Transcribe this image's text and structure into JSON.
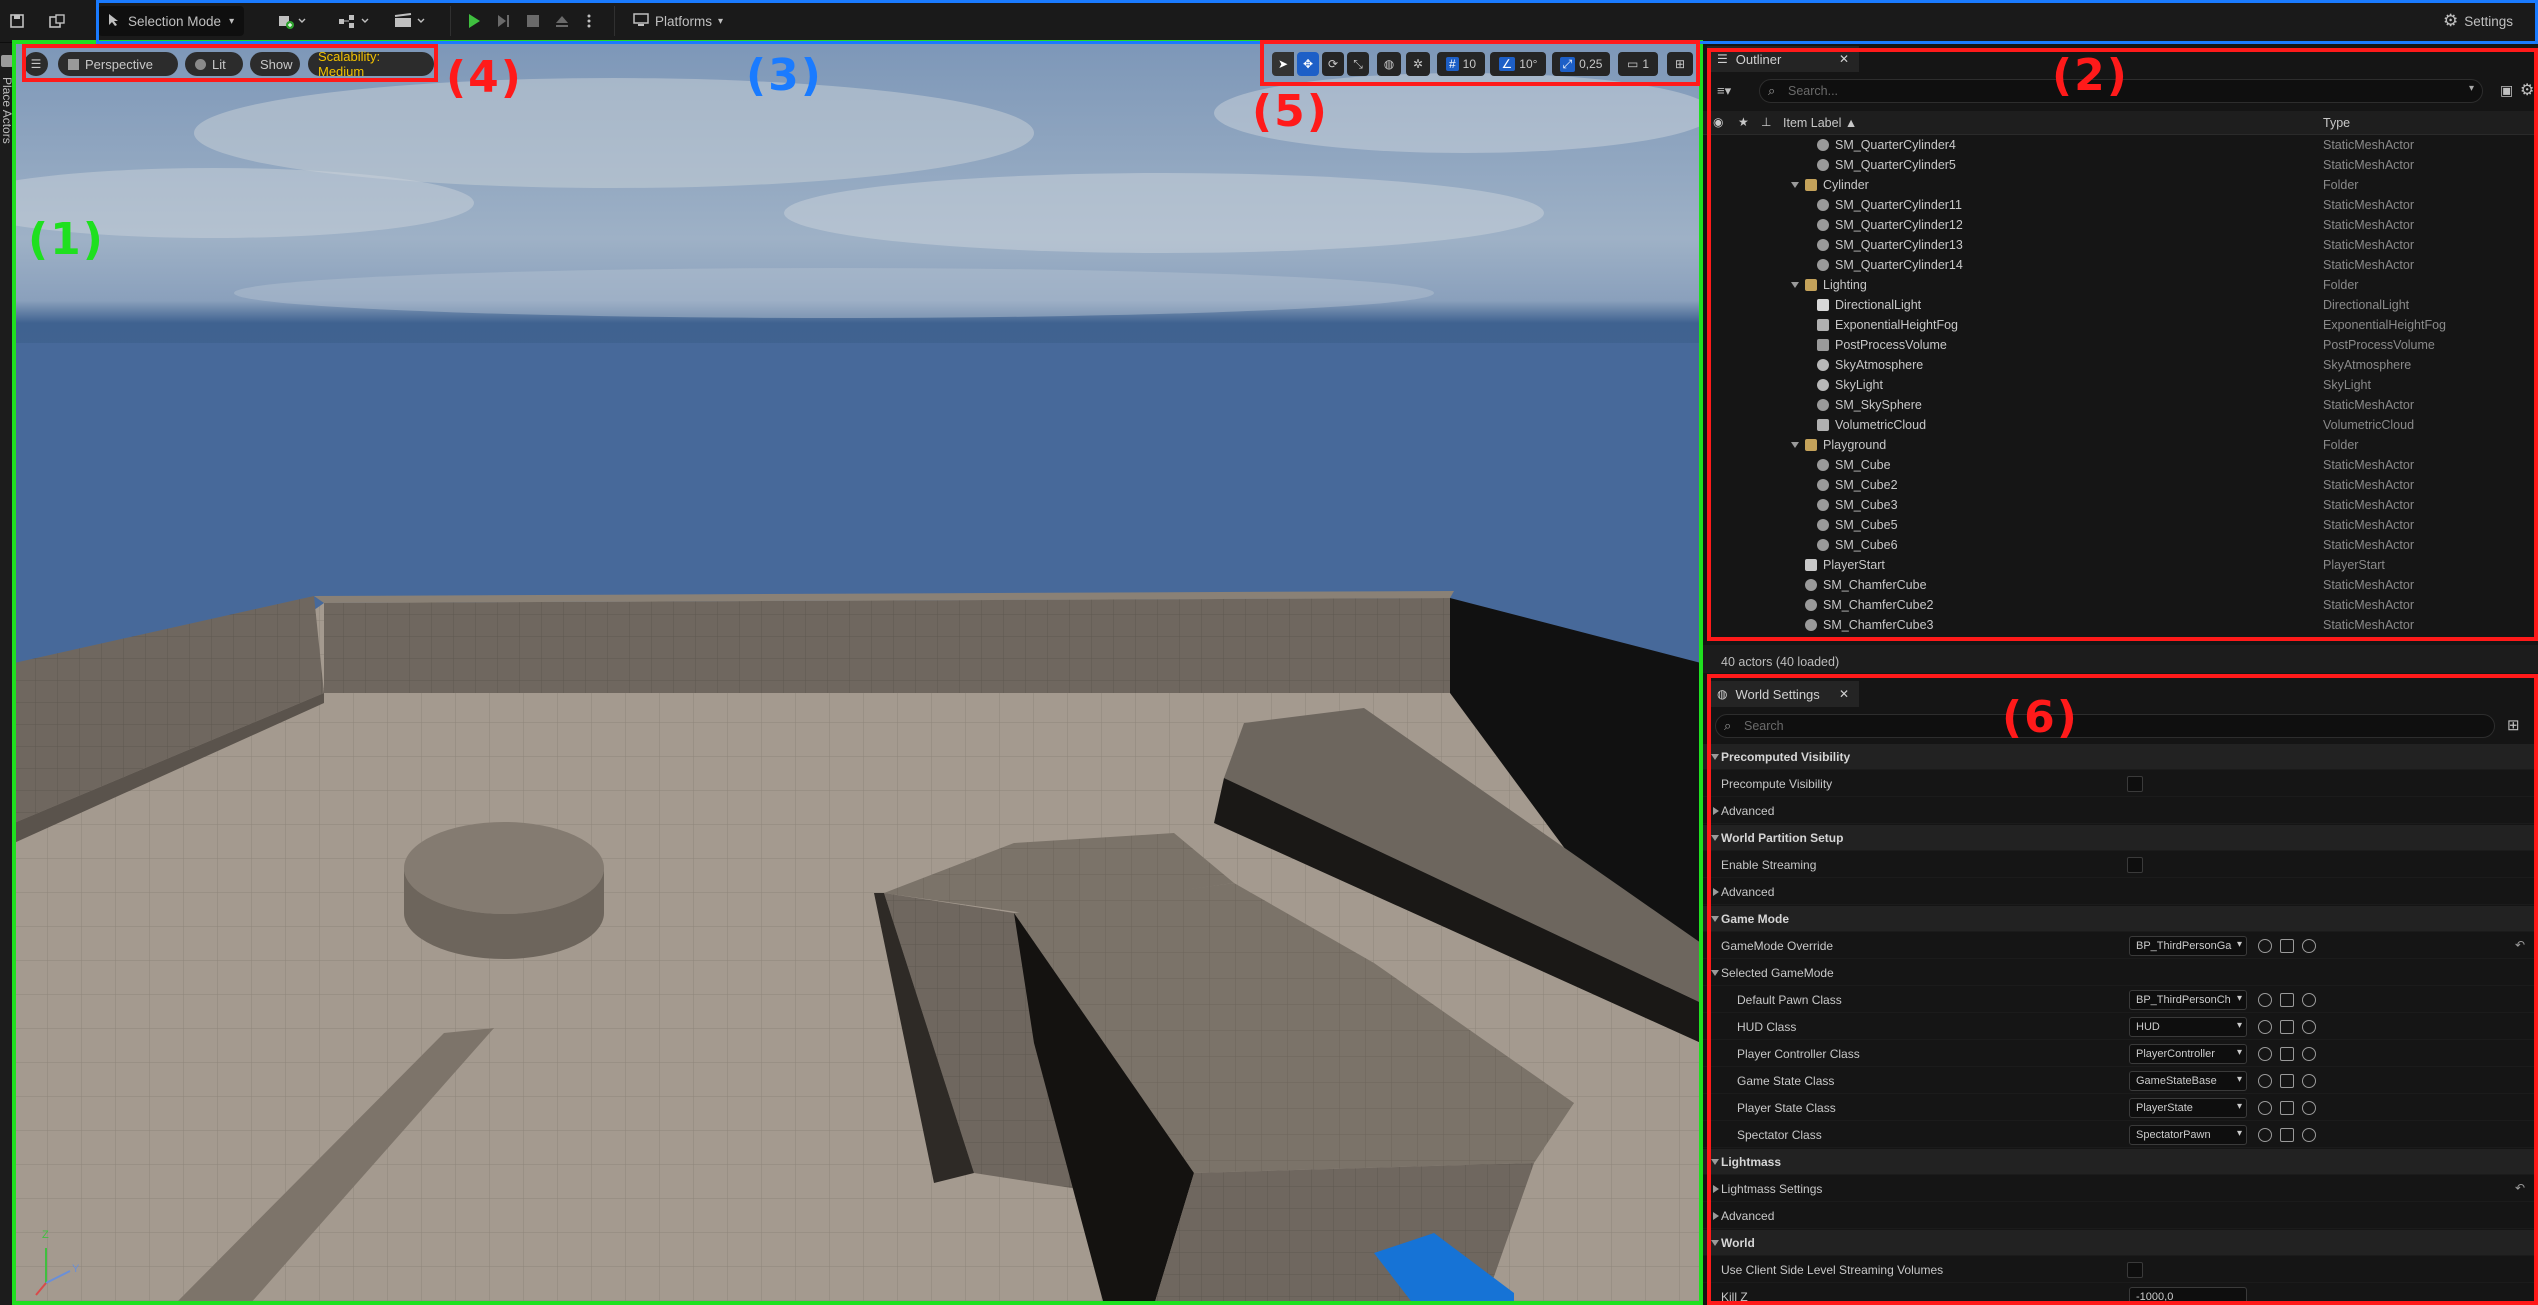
{
  "toolbar": {
    "mode_label": "Selection Mode",
    "platforms_label": "Platforms",
    "settings_label": "Settings"
  },
  "side_strip": {
    "label": "Place Actors"
  },
  "viewport": {
    "perspective_label": "Perspective",
    "lit_label": "Lit",
    "show_label": "Show",
    "scalability_label": "Scalability: Medium",
    "grid_snap_value": "10",
    "rotation_snap_value": "10°",
    "scale_snap_value": "0,25",
    "camera_speed_value": "1",
    "axis_labels": {
      "z": "Z",
      "y": "Y"
    }
  },
  "outliner": {
    "tab_label": "Outliner",
    "search_placeholder": "Search...",
    "col_label": "Item Label ▲",
    "col_type": "Type",
    "rows": [
      {
        "label": "SM_QuarterCylinder4",
        "type": "StaticMeshActor",
        "indent": 2,
        "kind": "mesh"
      },
      {
        "label": "SM_QuarterCylinder5",
        "type": "StaticMeshActor",
        "indent": 2,
        "kind": "mesh"
      },
      {
        "label": "Cylinder",
        "type": "Folder",
        "indent": 1,
        "kind": "folder"
      },
      {
        "label": "SM_QuarterCylinder11",
        "type": "StaticMeshActor",
        "indent": 2,
        "kind": "mesh"
      },
      {
        "label": "SM_QuarterCylinder12",
        "type": "StaticMeshActor",
        "indent": 2,
        "kind": "mesh"
      },
      {
        "label": "SM_QuarterCylinder13",
        "type": "StaticMeshActor",
        "indent": 2,
        "kind": "mesh"
      },
      {
        "label": "SM_QuarterCylinder14",
        "type": "StaticMeshActor",
        "indent": 2,
        "kind": "mesh"
      },
      {
        "label": "Lighting",
        "type": "Folder",
        "indent": 1,
        "kind": "folder"
      },
      {
        "label": "DirectionalLight",
        "type": "DirectionalLight",
        "indent": 2,
        "kind": "light"
      },
      {
        "label": "ExponentialHeightFog",
        "type": "ExponentialHeightFog",
        "indent": 2,
        "kind": "fog"
      },
      {
        "label": "PostProcessVolume",
        "type": "PostProcessVolume",
        "indent": 2,
        "kind": "volume"
      },
      {
        "label": "SkyAtmosphere",
        "type": "SkyAtmosphere",
        "indent": 2,
        "kind": "sky"
      },
      {
        "label": "SkyLight",
        "type": "SkyLight",
        "indent": 2,
        "kind": "sky"
      },
      {
        "label": "SM_SkySphere",
        "type": "StaticMeshActor",
        "indent": 2,
        "kind": "mesh"
      },
      {
        "label": "VolumetricCloud",
        "type": "VolumetricCloud",
        "indent": 2,
        "kind": "cloud"
      },
      {
        "label": "Playground",
        "type": "Folder",
        "indent": 1,
        "kind": "folder"
      },
      {
        "label": "SM_Cube",
        "type": "StaticMeshActor",
        "indent": 2,
        "kind": "mesh"
      },
      {
        "label": "SM_Cube2",
        "type": "StaticMeshActor",
        "indent": 2,
        "kind": "mesh"
      },
      {
        "label": "SM_Cube3",
        "type": "StaticMeshActor",
        "indent": 2,
        "kind": "mesh"
      },
      {
        "label": "SM_Cube5",
        "type": "StaticMeshActor",
        "indent": 2,
        "kind": "mesh"
      },
      {
        "label": "SM_Cube6",
        "type": "StaticMeshActor",
        "indent": 2,
        "kind": "mesh"
      },
      {
        "label": "PlayerStart",
        "type": "PlayerStart",
        "indent": 1,
        "kind": "player"
      },
      {
        "label": "SM_ChamferCube",
        "type": "StaticMeshActor",
        "indent": 1,
        "kind": "mesh"
      },
      {
        "label": "SM_ChamferCube2",
        "type": "StaticMeshActor",
        "indent": 1,
        "kind": "mesh"
      },
      {
        "label": "SM_ChamferCube3",
        "type": "StaticMeshActor",
        "indent": 1,
        "kind": "mesh"
      }
    ],
    "status": "40 actors (40 loaded)"
  },
  "world_settings": {
    "tab_label": "World Settings",
    "search_placeholder": "Search",
    "rows": [
      {
        "kind": "section",
        "label": "Precomputed Visibility"
      },
      {
        "kind": "check",
        "label": "Precompute Visibility",
        "indent": 1
      },
      {
        "kind": "collapsed",
        "label": "Advanced"
      },
      {
        "kind": "section",
        "label": "World Partition Setup"
      },
      {
        "kind": "check",
        "label": "Enable Streaming",
        "indent": 1
      },
      {
        "kind": "collapsed",
        "label": "Advanced"
      },
      {
        "kind": "section",
        "label": "Game Mode"
      },
      {
        "kind": "combo",
        "label": "GameMode Override",
        "value": "BP_ThirdPersonGa",
        "indent": 1,
        "reset": true
      },
      {
        "kind": "subsection",
        "label": "Selected GameMode",
        "indent": 1
      },
      {
        "kind": "combo",
        "label": "Default Pawn Class",
        "value": "BP_ThirdPersonCh",
        "indent": 2
      },
      {
        "kind": "combo",
        "label": "HUD Class",
        "value": "HUD",
        "indent": 2
      },
      {
        "kind": "combo",
        "label": "Player Controller Class",
        "value": "PlayerController",
        "indent": 2
      },
      {
        "kind": "combo",
        "label": "Game State Class",
        "value": "GameStateBase",
        "indent": 2
      },
      {
        "kind": "combo",
        "label": "Player State Class",
        "value": "PlayerState",
        "indent": 2
      },
      {
        "kind": "combo",
        "label": "Spectator Class",
        "value": "SpectatorPawn",
        "indent": 2
      },
      {
        "kind": "section",
        "label": "Lightmass"
      },
      {
        "kind": "collapsed",
        "label": "Lightmass Settings",
        "reset": true
      },
      {
        "kind": "collapsed",
        "label": "Advanced"
      },
      {
        "kind": "section",
        "label": "World"
      },
      {
        "kind": "check",
        "label": "Use Client Side Level Streaming Volumes",
        "indent": 1
      },
      {
        "kind": "number",
        "label": "Kill Z",
        "value": "-1000,0",
        "indent": 1
      }
    ]
  },
  "annotations": [
    {
      "label": "(1)",
      "color": "#1fe01f"
    },
    {
      "label": "(2)",
      "color": "#ff1a1a"
    },
    {
      "label": "(3)",
      "color": "#1a7bff"
    },
    {
      "label": "(4)",
      "color": "#ff1a1a"
    },
    {
      "label": "(5)",
      "color": "#ff1a1a"
    },
    {
      "label": "(6)",
      "color": "#ff1a1a"
    }
  ],
  "colors": {
    "accent": "#1d5fc7",
    "scalability": "#f0c000",
    "annotation_red": "#ff1a1a",
    "annotation_blue": "#1a7bff",
    "annotation_green": "#1fe01f"
  }
}
